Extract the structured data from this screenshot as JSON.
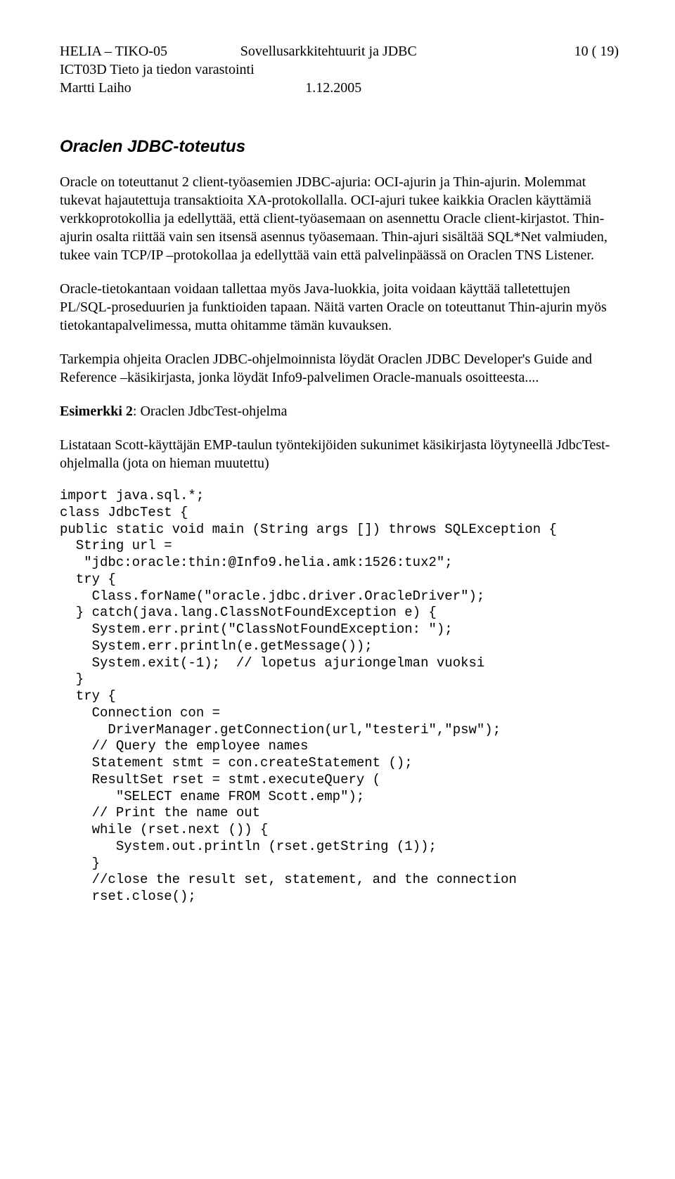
{
  "header": {
    "left1": "HELIA – TIKO-05",
    "center1": "Sovellusarkkitehtuurit ja JDBC",
    "right1": "10 ( 19)",
    "left2": "ICT03D  Tieto ja tiedon varastointi",
    "left3": "Martti Laiho",
    "center3": "1.12.2005"
  },
  "title": "Oraclen JDBC-toteutus",
  "para1": "Oracle on toteuttanut 2 client-työasemien JDBC-ajuria: OCI-ajurin ja Thin-ajurin. Molemmat tukevat hajautettuja transaktioita XA-protokollalla.  OCI-ajuri tukee kaikkia Oraclen käyttämiä verkkoprotokollia ja edellyttää, että client-työasemaan on asennettu Oracle client-kirjastot. Thin-ajurin osalta riittää vain sen itsensä asennus työasemaan. Thin-ajuri sisältää SQL*Net valmiuden, tukee vain TCP/IP –protokollaa ja edellyttää vain että palvelinpäässä on Oraclen TNS  Listener.",
  "para2": "Oracle-tietokantaan voidaan tallettaa myös Java-luokkia, joita voidaan käyttää talletettujen PL/SQL-proseduurien ja funktioiden tapaan.  Näitä varten Oracle on toteuttanut Thin-ajurin myös tietokantapalvelimessa, mutta ohitamme tämän kuvauksen.",
  "para3": "Tarkempia ohjeita Oraclen JDBC-ohjelmoinnista löydät Oraclen JDBC Developer's Guide and Reference –käsikirjasta, jonka löydät Info9-palvelimen Oracle-manuals osoitteesta....",
  "example_label_bold": "Esimerkki 2",
  "example_label_rest": ":  Oraclen JdbcTest-ohjelma",
  "para4": "Listataan Scott-käyttäjän EMP-taulun työntekijöiden sukunimet käsikirjasta löytyneellä JdbcTest-ohjelmalla (jota on hieman muutettu)",
  "code": "import java.sql.*;\nclass JdbcTest {\npublic static void main (String args []) throws SQLException {\n  String url =\n   \"jdbc:oracle:thin:@Info9.helia.amk:1526:tux2\";\n  try {\n    Class.forName(\"oracle.jdbc.driver.OracleDriver\");\n  } catch(java.lang.ClassNotFoundException e) {\n    System.err.print(\"ClassNotFoundException: \");\n    System.err.println(e.getMessage());\n    System.exit(-1);  // lopetus ajuriongelman vuoksi\n  }\n  try {\n    Connection con =\n      DriverManager.getConnection(url,\"testeri\",\"psw\");\n    // Query the employee names\n    Statement stmt = con.createStatement ();\n    ResultSet rset = stmt.executeQuery (\n       \"SELECT ename FROM Scott.emp\");\n    // Print the name out\n    while (rset.next ()) {\n       System.out.println (rset.getString (1));\n    }\n    //close the result set, statement, and the connection\n    rset.close();"
}
